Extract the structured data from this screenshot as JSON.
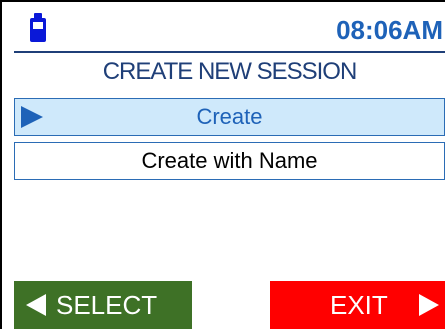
{
  "status_bar": {
    "battery_icon": "battery-icon",
    "time": "08:06AM"
  },
  "screen": {
    "title": "CREATE NEW SESSION"
  },
  "menu": {
    "items": [
      {
        "label": "Create",
        "selected": true
      },
      {
        "label": "Create with Name",
        "selected": false
      }
    ]
  },
  "softkeys": {
    "left_label": "SELECT",
    "right_label": "EXIT"
  },
  "colors": {
    "accent": "#1e62b8",
    "select_bg": "#cfe9fb",
    "select_key": "#3e7126",
    "exit_key": "#ff0000",
    "battery": "#0a18d8"
  }
}
